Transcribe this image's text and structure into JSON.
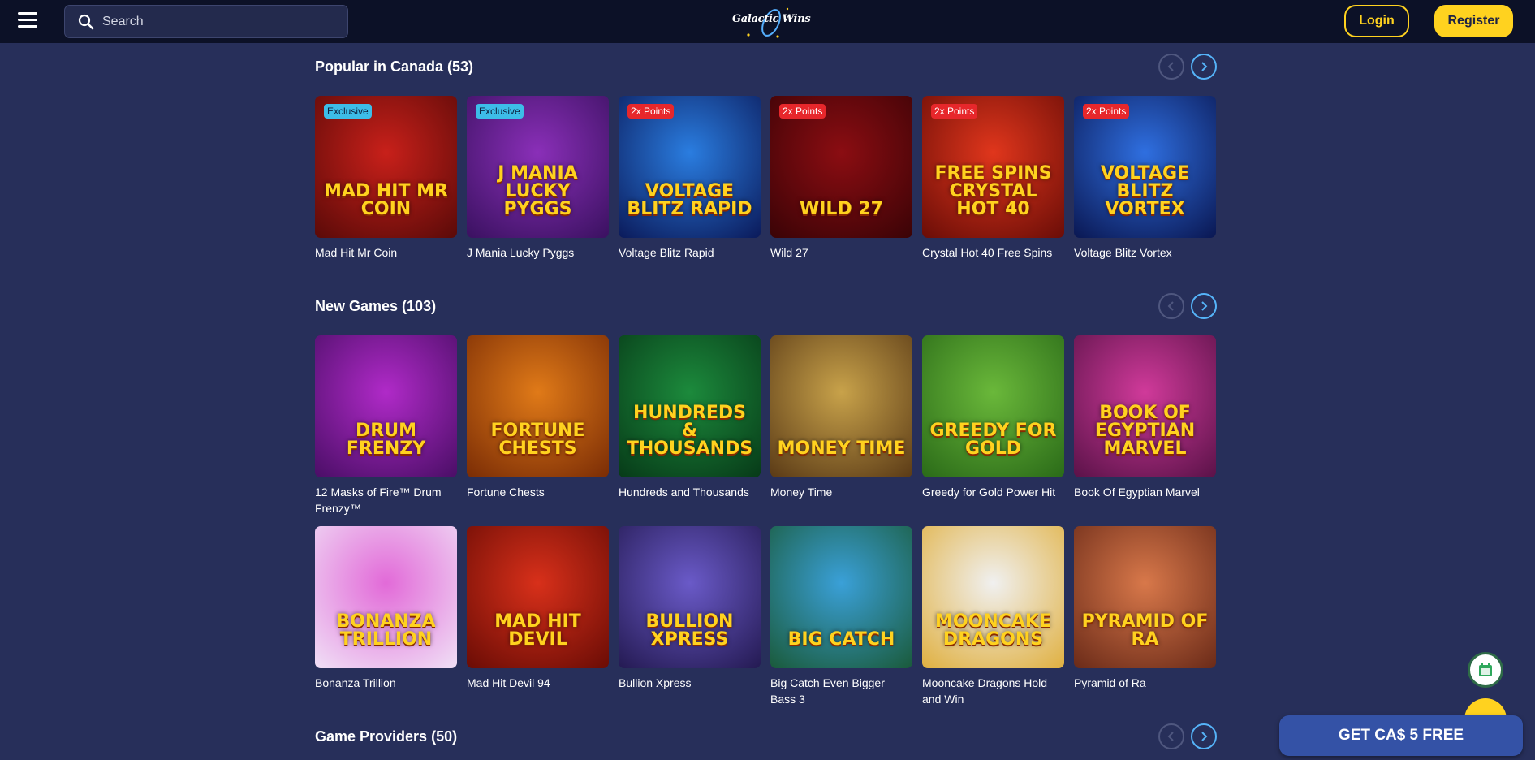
{
  "header": {
    "search_placeholder": "Search",
    "logo_text": "Galactic Wins",
    "login_label": "Login",
    "register_label": "Register"
  },
  "sections": [
    {
      "title": "Popular in Canada (53)",
      "games": [
        {
          "name": "Mad Hit Mr Coin",
          "art": "MAD HIT MR COIN",
          "badge": "Exclusive",
          "badge_type": "exclusive",
          "colors": [
            "#c8201a",
            "#5a0a08"
          ]
        },
        {
          "name": "J Mania Lucky Pyggs",
          "art": "J MANIA LUCKY PYGGS",
          "badge": "Exclusive",
          "badge_type": "exclusive",
          "colors": [
            "#8a2fb8",
            "#3a1160"
          ]
        },
        {
          "name": "Voltage Blitz Rapid",
          "art": "VOLTAGE BLITZ RAPID",
          "badge": "2x Points",
          "badge_type": "points",
          "colors": [
            "#2a7de0",
            "#0b1a5a"
          ]
        },
        {
          "name": "Wild 27",
          "art": "WILD 27",
          "badge": "2x Points",
          "badge_type": "points",
          "colors": [
            "#8b0d12",
            "#3a0306"
          ]
        },
        {
          "name": "Crystal Hot 40 Free Spins",
          "art": "FREE SPINS CRYSTAL HOT 40",
          "badge": "2x Points",
          "badge_type": "points",
          "colors": [
            "#e0361c",
            "#6a0d07"
          ]
        },
        {
          "name": "Voltage Blitz Vortex",
          "art": "VOLTAGE BLITZ VORTEX",
          "badge": "2x Points",
          "badge_type": "points",
          "colors": [
            "#2f6fe0",
            "#0a1752"
          ]
        }
      ]
    },
    {
      "title": "New Games (103)",
      "games": [
        {
          "name": "12 Masks of Fire™ Drum Frenzy™",
          "art": "DRUM FRENZY",
          "colors": [
            "#b02ac8",
            "#4a0e66"
          ]
        },
        {
          "name": "Fortune Chests",
          "art": "FORTUNE CHESTS",
          "colors": [
            "#e07a18",
            "#7a2c05"
          ]
        },
        {
          "name": "Hundreds and Thousands",
          "art": "HUNDREDS & THOUSANDS",
          "colors": [
            "#1c8a3c",
            "#073a18"
          ]
        },
        {
          "name": "Money Time",
          "art": "MONEY TIME",
          "colors": [
            "#c8a24a",
            "#5a3a16"
          ]
        },
        {
          "name": "Greedy for Gold Power Hit",
          "art": "GREEDY FOR GOLD",
          "colors": [
            "#6ab83a",
            "#2a6a18"
          ]
        },
        {
          "name": "Book Of Egyptian Marvel",
          "art": "BOOK OF EGYPTIAN MARVEL",
          "colors": [
            "#d03a9a",
            "#5a1248"
          ]
        },
        {
          "name": "Bonanza Trillion",
          "art": "BONANZA TRILLION",
          "colors": [
            "#e26ad8",
            "#f0e0f6"
          ]
        },
        {
          "name": "Mad Hit Devil 94",
          "art": "MAD HIT DEVIL",
          "colors": [
            "#d8301a",
            "#6a0c05"
          ]
        },
        {
          "name": "Bullion Xpress",
          "art": "BULLION XPRESS",
          "colors": [
            "#6a5ac8",
            "#241a52"
          ]
        },
        {
          "name": "Big Catch Even Bigger Bass 3",
          "art": "BIG CATCH",
          "colors": [
            "#3aa0d8",
            "#1a5a3a"
          ]
        },
        {
          "name": "Mooncake Dragons Hold and Win",
          "art": "MOONCAKE DRAGONS",
          "colors": [
            "#f0f0f0",
            "#e0b040"
          ]
        },
        {
          "name": "Pyramid of Ra",
          "art": "PYRAMID OF RA",
          "colors": [
            "#d8784a",
            "#6a2a18"
          ]
        }
      ]
    },
    {
      "title": "Game Providers (50)",
      "games": []
    }
  ],
  "cta_label": "GET CA$ 5 FREE",
  "icons": {
    "menu": "hamburger-icon",
    "search": "search-icon",
    "prev": "chevron-left-icon",
    "next": "chevron-right-icon",
    "calendar": "calendar-icon",
    "chat": "chat-icon"
  }
}
